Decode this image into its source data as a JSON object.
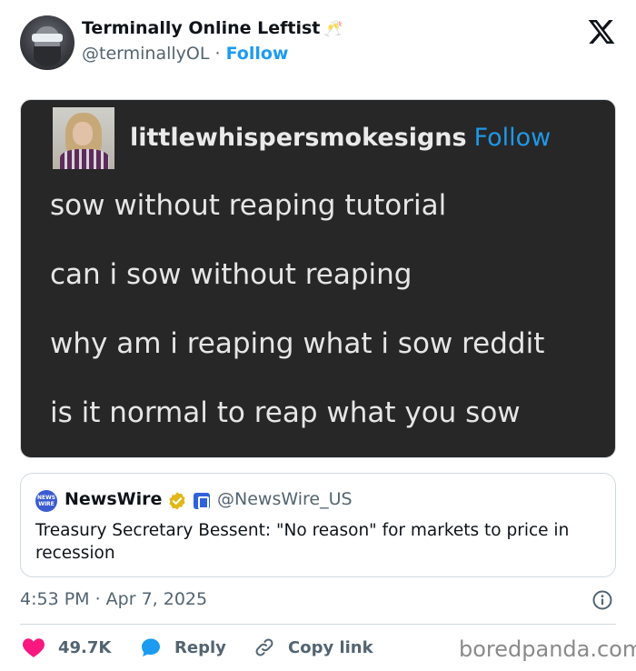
{
  "author": {
    "name": "Terminally Online Leftist",
    "emoji": "🥂",
    "handle": "@terminallyOL",
    "separator": "·",
    "follow_label": "Follow"
  },
  "embedded_post": {
    "username": "littlewhispersmokesigns",
    "follow_label": "Follow",
    "lines": [
      "sow without reaping tutorial",
      "can i sow without reaping",
      "why am i reaping what i sow reddit",
      "is it normal to reap what you sow"
    ]
  },
  "quoted_tweet": {
    "logo_text": "NEWS WIRE",
    "name": "NewsWire",
    "handle": "@NewsWire_US",
    "text": "Treasury Secretary Bessent: \"No reason\" for markets to price in recession"
  },
  "timestamp": "4:53 PM · Apr 7, 2025",
  "actions": {
    "likes": "49.7K",
    "reply_label": "Reply",
    "copy_link_label": "Copy link"
  },
  "watermark": "boredpanda.com",
  "colors": {
    "accent": "#1d9bf0",
    "heart": "#f91880",
    "dark_card": "#272727",
    "verified_gold": "#e2b719"
  }
}
